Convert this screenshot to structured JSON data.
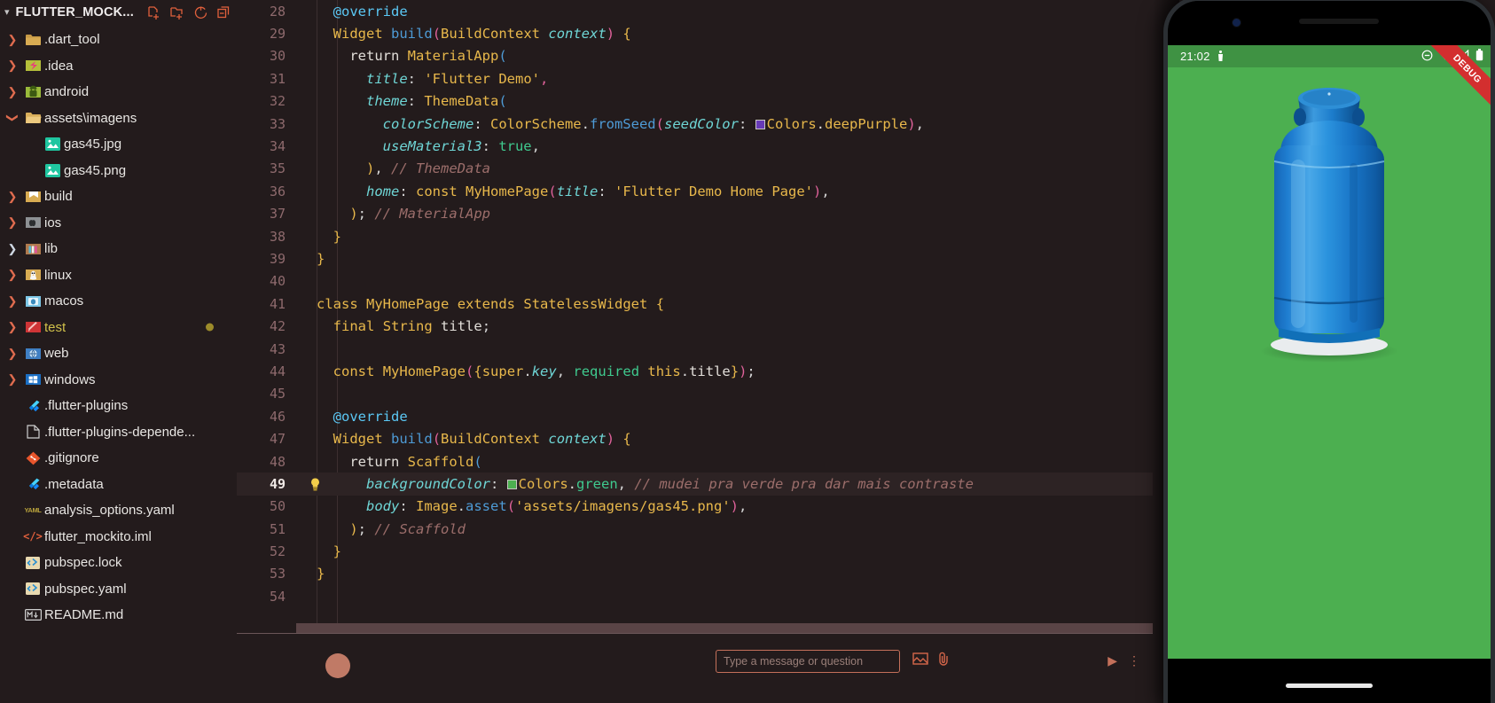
{
  "sidebar": {
    "project_title": "FLUTTER_MOCK...",
    "header_actions": [
      {
        "name": "new-file-icon",
        "label": "New File"
      },
      {
        "name": "new-folder-icon",
        "label": "New Folder"
      },
      {
        "name": "refresh-icon",
        "label": "Refresh Explorer"
      },
      {
        "name": "collapse-all-icon",
        "label": "Collapse Folders in Explorer"
      }
    ],
    "items": [
      {
        "label": ".dart_tool",
        "icon": "folder-icon",
        "chevron": "collapsed",
        "indent": 0,
        "color": "#e8e6e3"
      },
      {
        "label": ".idea",
        "icon": "idea-icon",
        "chevron": "collapsed",
        "indent": 0,
        "color": "#e8e6e3"
      },
      {
        "label": "android",
        "icon": "android-icon",
        "chevron": "collapsed",
        "indent": 0,
        "color": "#e8e6e3"
      },
      {
        "label": "assets\\imagens",
        "icon": "folder-open-icon",
        "chevron": "expanded",
        "indent": 0,
        "color": "#e8e6e3"
      },
      {
        "label": "gas45.jpg",
        "icon": "image-file-icon",
        "chevron": "none",
        "indent": 1,
        "color": "#e8e6e3"
      },
      {
        "label": "gas45.png",
        "icon": "image-file-icon",
        "chevron": "none",
        "indent": 1,
        "color": "#e8e6e3"
      },
      {
        "label": "build",
        "icon": "build-folder-icon",
        "chevron": "collapsed",
        "indent": 0,
        "color": "#e8e6e3"
      },
      {
        "label": "ios",
        "icon": "apple-icon",
        "chevron": "collapsed",
        "indent": 0,
        "color": "#e8e6e3"
      },
      {
        "label": "lib",
        "icon": "library-icon",
        "chevron": "collapsed-blue",
        "indent": 0,
        "color": "#e8e6e3"
      },
      {
        "label": "linux",
        "icon": "linux-icon",
        "chevron": "collapsed",
        "indent": 0,
        "color": "#e8e6e3"
      },
      {
        "label": "macos",
        "icon": "macos-icon",
        "chevron": "collapsed",
        "indent": 0,
        "color": "#e8e6e3"
      },
      {
        "label": "test",
        "icon": "test-folder-icon",
        "chevron": "collapsed",
        "indent": 0,
        "color": "#d0c04a",
        "modified": true
      },
      {
        "label": "web",
        "icon": "web-icon",
        "chevron": "collapsed",
        "indent": 0,
        "color": "#e8e6e3"
      },
      {
        "label": "windows",
        "icon": "windows-icon",
        "chevron": "collapsed",
        "indent": 0,
        "color": "#e8e6e3"
      },
      {
        "label": ".flutter-plugins",
        "icon": "flutter-icon",
        "chevron": "none",
        "indent": 0,
        "color": "#e8e6e3"
      },
      {
        "label": ".flutter-plugins-depende...",
        "icon": "text-file-icon",
        "chevron": "none",
        "indent": 0,
        "color": "#e8e6e3"
      },
      {
        "label": ".gitignore",
        "icon": "git-icon",
        "chevron": "none",
        "indent": 0,
        "color": "#e8e6e3"
      },
      {
        "label": ".metadata",
        "icon": "flutter-icon",
        "chevron": "none",
        "indent": 0,
        "color": "#e8e6e3"
      },
      {
        "label": "analysis_options.yaml",
        "icon": "yaml-icon",
        "chevron": "none",
        "indent": 0,
        "color": "#e8e6e3"
      },
      {
        "label": "flutter_mockito.iml",
        "icon": "xml-icon",
        "chevron": "none",
        "indent": 0,
        "color": "#e8e6e3"
      },
      {
        "label": "pubspec.lock",
        "icon": "pubspec-icon",
        "chevron": "none",
        "indent": 0,
        "color": "#e8e6e3"
      },
      {
        "label": "pubspec.yaml",
        "icon": "pubspec-icon",
        "chevron": "none",
        "indent": 0,
        "color": "#e8e6e3"
      },
      {
        "label": "README.md",
        "icon": "markdown-icon",
        "chevron": "none",
        "indent": 0,
        "color": "#e8e6e3"
      }
    ]
  },
  "editor": {
    "first_visible_line": 28,
    "current_line": 49,
    "lightbulb_line": 49,
    "lines": [
      {
        "n": 28,
        "html": "<span class=\"t-plain\">  </span><span class=\"t-ann\">@override</span>"
      },
      {
        "n": 29,
        "html": "<span class=\"t-plain\">  </span><span class=\"t-type\">Widget</span> <span class=\"t-fn\">build</span><span class=\"t-paren\">(</span><span class=\"t-type\">BuildContext</span> <span class=\"t-param\">context</span><span class=\"t-paren\">)</span> <span class=\"t-paren2\">{</span>"
      },
      {
        "n": 30,
        "html": "<span class=\"t-plain\">    return </span><span class=\"t-type\">MaterialApp</span><span class=\"t-fn\">(</span>"
      },
      {
        "n": 31,
        "html": "<span class=\"t-plain\">      </span><span class=\"t-param\">title</span><span class=\"t-punc\">: </span><span class=\"t-str\">'Flutter Demo'</span><span class=\"t-paren\">,</span>"
      },
      {
        "n": 32,
        "html": "<span class=\"t-plain\">      </span><span class=\"t-param\">theme</span><span class=\"t-punc\">: </span><span class=\"t-type\">ThemeData</span><span class=\"t-fn\">(</span>"
      },
      {
        "n": 33,
        "html": "<span class=\"t-plain\">        </span><span class=\"t-param\">colorScheme</span><span class=\"t-punc\">: </span><span class=\"t-type\">ColorScheme</span><span class=\"t-punc\">.</span><span class=\"t-fn\">fromSeed</span><span class=\"t-paren\">(</span><span class=\"t-param\">seedColor</span><span class=\"t-punc\">: </span><span class=\"swatch sw-purple\"></span><span class=\"t-type\">Colors</span><span class=\"t-plain\">.</span><span class=\"t-type\">deepPurple</span><span class=\"t-paren\">)</span><span class=\"t-punc\">,</span>"
      },
      {
        "n": 34,
        "html": "<span class=\"t-plain\">        </span><span class=\"t-param\">useMaterial3</span><span class=\"t-punc\">: </span><span class=\"t-bool\">true</span><span class=\"t-punc\">,</span>"
      },
      {
        "n": 35,
        "html": "<span class=\"t-plain\">      </span><span class=\"t-paren2\">)</span><span class=\"t-punc\">, </span><span class=\"t-cmt\">// ThemeData</span>"
      },
      {
        "n": 36,
        "html": "<span class=\"t-plain\">      </span><span class=\"t-param\">home</span><span class=\"t-punc\">: </span><span class=\"t-kw\">const</span> <span class=\"t-type\">MyHomePage</span><span class=\"t-paren\">(</span><span class=\"t-param\">title</span><span class=\"t-punc\">: </span><span class=\"t-str\">'Flutter Demo Home Page'</span><span class=\"t-paren\">)</span><span class=\"t-punc\">,</span>"
      },
      {
        "n": 37,
        "html": "<span class=\"t-plain\">    </span><span class=\"t-paren2\">)</span><span class=\"t-punc\">; </span><span class=\"t-cmt\">// MaterialApp</span>"
      },
      {
        "n": 38,
        "html": "<span class=\"t-plain\">  </span><span class=\"t-paren2\">}</span>"
      },
      {
        "n": 39,
        "html": "<span class=\"t-paren2\">}</span>"
      },
      {
        "n": 40,
        "html": ""
      },
      {
        "n": 41,
        "html": "<span class=\"t-kw\">class</span> <span class=\"t-type\">MyHomePage</span> <span class=\"t-kw\">extends</span> <span class=\"t-type\">StatelessWidget</span> <span class=\"t-paren2\">{</span>"
      },
      {
        "n": 42,
        "html": "<span class=\"t-plain\">  </span><span class=\"t-kw\">final</span> <span class=\"t-type\">String</span> <span class=\"t-plain\">title</span><span class=\"t-punc\">;</span>"
      },
      {
        "n": 43,
        "html": ""
      },
      {
        "n": 44,
        "html": "<span class=\"t-plain\">  </span><span class=\"t-kw\">const</span> <span class=\"t-type\">MyHomePage</span><span class=\"t-paren\">(</span><span class=\"t-paren2\">{</span><span class=\"t-kw\">super</span><span class=\"t-punc\">.</span><span class=\"t-param\">key</span><span class=\"t-punc\">, </span><span class=\"t-green\">required</span> <span class=\"t-kw\">this</span><span class=\"t-punc\">.</span><span class=\"t-plain\">title</span><span class=\"t-paren2\">}</span><span class=\"t-paren\">)</span><span class=\"t-punc\">;</span>"
      },
      {
        "n": 45,
        "html": ""
      },
      {
        "n": 46,
        "html": "<span class=\"t-plain\">  </span><span class=\"t-ann\">@override</span>"
      },
      {
        "n": 47,
        "html": "<span class=\"t-plain\">  </span><span class=\"t-type\">Widget</span> <span class=\"t-fn\">build</span><span class=\"t-paren\">(</span><span class=\"t-type\">BuildContext</span> <span class=\"t-param\">context</span><span class=\"t-paren\">)</span> <span class=\"t-paren2\">{</span>"
      },
      {
        "n": 48,
        "html": "<span class=\"t-plain\">    return </span><span class=\"t-type\">Scaffold</span><span class=\"t-fn\">(</span>"
      },
      {
        "n": 49,
        "html": "<span class=\"t-plain\">      </span><span class=\"t-param\">backgroundColor</span><span class=\"t-punc\">: </span><span class=\"swatch sw-green\"></span><span class=\"t-type\">Colors</span><span class=\"t-plain\">.</span><span class=\"t-green\">green</span><span class=\"t-punc\">, </span><span class=\"t-cmt\">// mudei pra verde pra dar mais contraste</span>"
      },
      {
        "n": 50,
        "html": "<span class=\"t-plain\">      </span><span class=\"t-param\">body</span><span class=\"t-punc\">: </span><span class=\"t-type\">Image</span><span class=\"t-punc\">.</span><span class=\"t-fn\">asset</span><span class=\"t-paren\">(</span><span class=\"t-str\">'assets/imagens/gas45.png'</span><span class=\"t-paren\">)</span><span class=\"t-punc\">,</span>"
      },
      {
        "n": 51,
        "html": "<span class=\"t-plain\">    </span><span class=\"t-paren2\">)</span><span class=\"t-punc\">; </span><span class=\"t-cmt\">// Scaffold</span>"
      },
      {
        "n": 52,
        "html": "<span class=\"t-plain\">  </span><span class=\"t-paren2\">}</span>"
      },
      {
        "n": 53,
        "html": "<span class=\"t-paren2\">}</span>"
      },
      {
        "n": 54,
        "html": ""
      }
    ]
  },
  "bottom_panel": {
    "input_placeholder": "Type a message or question",
    "icons": [
      "image-attach-icon",
      "attachment-icon"
    ],
    "right_icons": [
      "send-icon",
      "more-icon"
    ]
  },
  "phone": {
    "status_time": "21:02",
    "status_left_icon": "notification-icon",
    "status_right_icons": [
      "do-not-disturb-icon",
      "wifi-icon",
      "signal-icon",
      "battery-icon"
    ],
    "debug_banner": "DEBUG",
    "screen_background": "#4caf50",
    "content_image": "gas45.png",
    "gesture_bar": true
  }
}
